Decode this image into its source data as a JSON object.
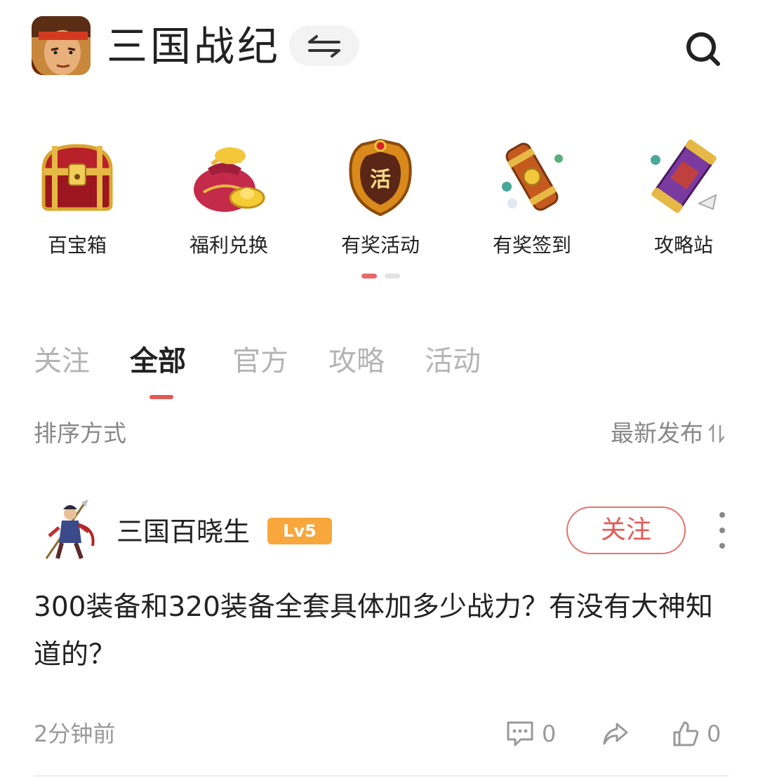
{
  "header": {
    "title": "三国战纪",
    "avatar_icon": "hero-portrait-icon",
    "switch_icon": "swap-arrows-icon",
    "search_icon": "search-icon"
  },
  "shortcuts": [
    {
      "label": "百宝箱",
      "icon": "treasure-chest-icon"
    },
    {
      "label": "福利兑换",
      "icon": "money-bag-icon"
    },
    {
      "label": "有奖活动",
      "icon": "activity-token-icon",
      "glyph": "活"
    },
    {
      "label": "有奖签到",
      "icon": "scroll-lantern-icon"
    },
    {
      "label": "攻略站",
      "icon": "scroll-guide-icon"
    }
  ],
  "pager": {
    "active_color": "#e8696a",
    "inactive_color": "#e2e2e2",
    "count": 2,
    "active_index": 0
  },
  "tabs": [
    {
      "label": "关注",
      "active": false
    },
    {
      "label": "全部",
      "active": true
    },
    {
      "label": "官方",
      "active": false
    },
    {
      "label": "攻略",
      "active": false
    },
    {
      "label": "活动",
      "active": false
    }
  ],
  "sort": {
    "label": "排序方式",
    "value": "最新发布",
    "icon": "sort-arrows-icon"
  },
  "post": {
    "author": "三国百晓生",
    "level": "Lv5",
    "follow_label": "关注",
    "content": "300装备和320装备全套具体加多少战力？有没有大神知道的？",
    "time": "2分钟前",
    "comments": "0",
    "likes": "0"
  },
  "colors": {
    "accent": "#e25a55",
    "badge": "#f7a73c",
    "muted": "#999999"
  }
}
